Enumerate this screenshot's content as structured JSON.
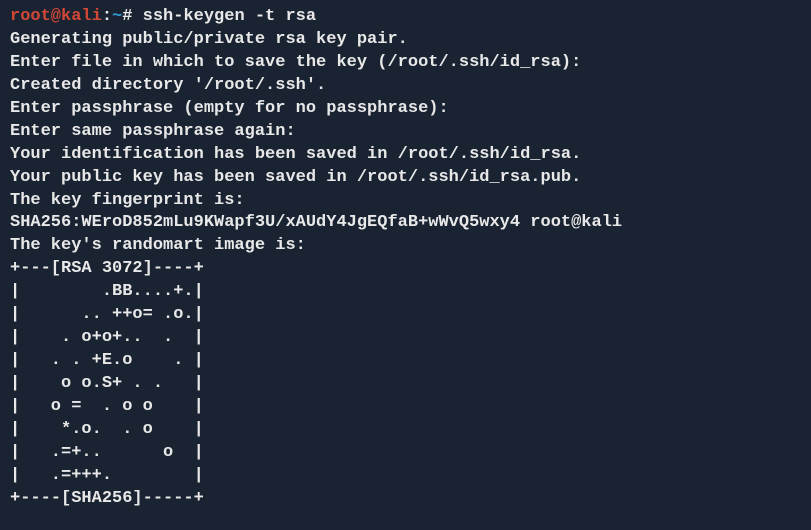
{
  "prompt": {
    "user": "root@kali",
    "separator": ":",
    "path": "~",
    "symbol": "# "
  },
  "command": "ssh-keygen -t rsa",
  "output": [
    "Generating public/private rsa key pair.",
    "Enter file in which to save the key (/root/.ssh/id_rsa):",
    "Created directory '/root/.ssh'.",
    "Enter passphrase (empty for no passphrase):",
    "Enter same passphrase again:",
    "Your identification has been saved in /root/.ssh/id_rsa.",
    "Your public key has been saved in /root/.ssh/id_rsa.pub.",
    "The key fingerprint is:",
    "SHA256:WEroD852mLu9KWapf3U/xAUdY4JgEQfaB+wWvQ5wxy4 root@kali",
    "The key's randomart image is:",
    "+---[RSA 3072]----+",
    "|        .BB....+.|",
    "|      .. ++o= .o.|",
    "|    . o+o+..  .  |",
    "|   . . +E.o    . |",
    "|    o o.S+ . .   |",
    "|   o =  . o o    |",
    "|    *.o.  . o    |",
    "|   .=+..      o  |",
    "|   .=+++.        |",
    "+----[SHA256]-----+"
  ],
  "colors": {
    "background": "#1a2332",
    "promptUser": "#d14836",
    "promptPath": "#2e9bd6",
    "text": "#e8e8e8"
  }
}
